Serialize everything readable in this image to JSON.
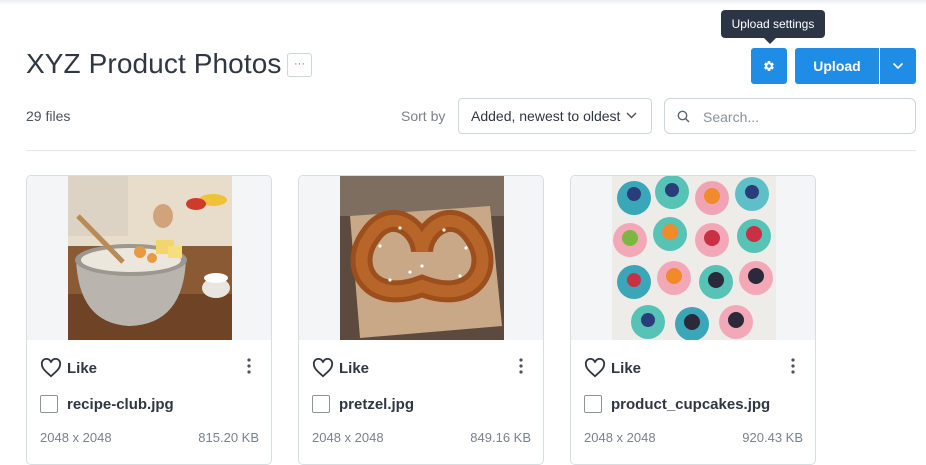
{
  "header": {
    "title": "XYZ Product Photos",
    "more_label": "···",
    "tooltip": "Upload settings",
    "settings_icon": "gear-icon",
    "upload_label": "Upload",
    "dropdown_icon": "chevron-down-icon",
    "accent_color": "#1f8ce6"
  },
  "toolbar": {
    "file_count": "29 files",
    "sort_label": "Sort by",
    "sort_value": "Added, newest to oldest",
    "search_placeholder": "Search..."
  },
  "files": [
    {
      "like_label": "Like",
      "name": "recipe-club.jpg",
      "dimensions": "2048 x 2048",
      "size": "815.20 KB"
    },
    {
      "like_label": "Like",
      "name": "pretzel.jpg",
      "dimensions": "2048 x 2048",
      "size": "849.16 KB"
    },
    {
      "like_label": "Like",
      "name": "product_cupcakes.jpg",
      "dimensions": "2048 x 2048",
      "size": "920.43 KB"
    }
  ]
}
